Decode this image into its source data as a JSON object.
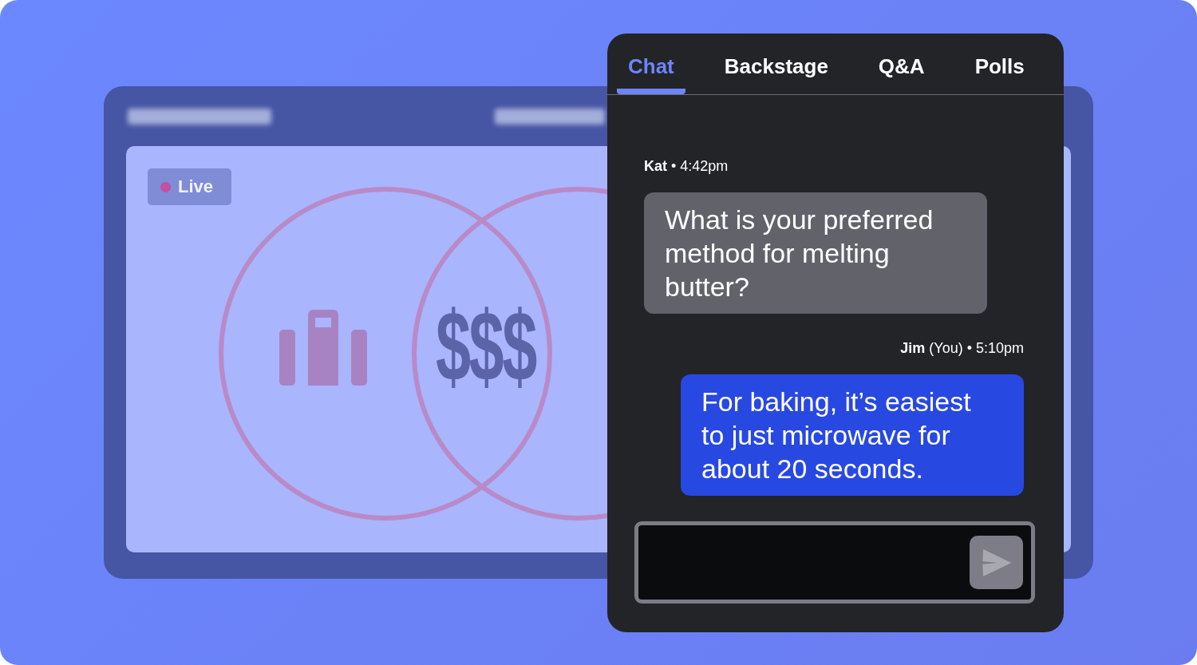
{
  "background_window": {
    "live_badge": {
      "label": "Live"
    },
    "slide": {
      "symbol": "$$$"
    }
  },
  "chat_panel": {
    "tabs": [
      {
        "label": "Chat",
        "selected": true
      },
      {
        "label": "Backstage",
        "selected": false
      },
      {
        "label": "Q&A",
        "selected": false
      },
      {
        "label": "Polls",
        "selected": false
      }
    ],
    "messages": [
      {
        "meta": "**Kat** • 4:42pm",
        "text": "What is your preferred method for melting butter?",
        "own": false
      },
      {
        "meta": "**Jim** (You) • 5:10pm",
        "text": "For baking, it’s easiest to just microwave for about 20 seconds.",
        "own": true
      }
    ]
  }
}
